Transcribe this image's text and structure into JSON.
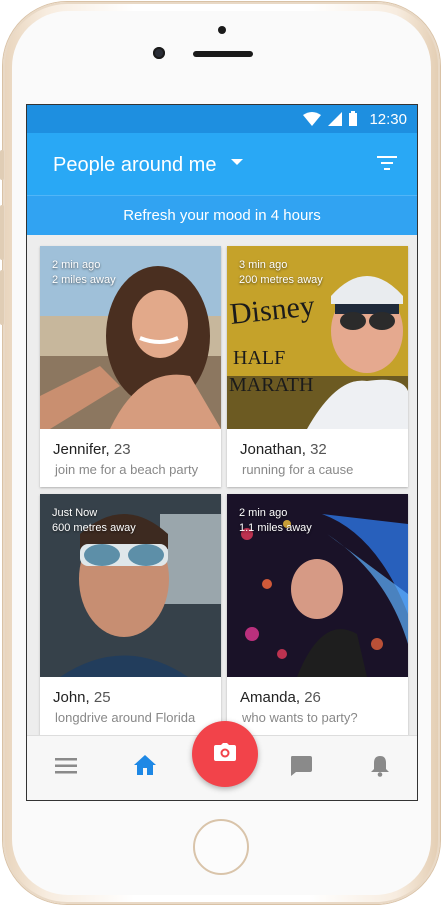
{
  "status": {
    "time": "12:30"
  },
  "appbar": {
    "title": "People around me"
  },
  "banner": {
    "text": "Refresh your mood  in 4 hours"
  },
  "cards": [
    {
      "time": "2 min ago",
      "distance": "2 miles away",
      "name": "Jennifer,",
      "age": "23",
      "tagline": "join me for a beach party"
    },
    {
      "time": "3 min ago",
      "distance": "200 metres away",
      "name": "Jonathan,",
      "age": "32",
      "tagline": "running for a cause"
    },
    {
      "time": "Just Now",
      "distance": "600 metres away",
      "name": "John,",
      "age": "25",
      "tagline": "longdrive around Florida"
    },
    {
      "time": "2 min ago",
      "distance": "1.1 miles away",
      "name": "Amanda,",
      "age": "26",
      "tagline": "who wants to party?"
    }
  ],
  "icons": {
    "menu": "menu-icon",
    "home": "home-icon",
    "camera": "camera-icon",
    "chat": "chat-icon",
    "bell": "bell-icon",
    "filter": "filter-icon",
    "dropdown": "chevron-down-icon"
  },
  "colors": {
    "statusbar": "#1e8fe0",
    "appbar": "#29a8f5",
    "accent_active": "#1e88e5",
    "fab": "#f2434a"
  }
}
